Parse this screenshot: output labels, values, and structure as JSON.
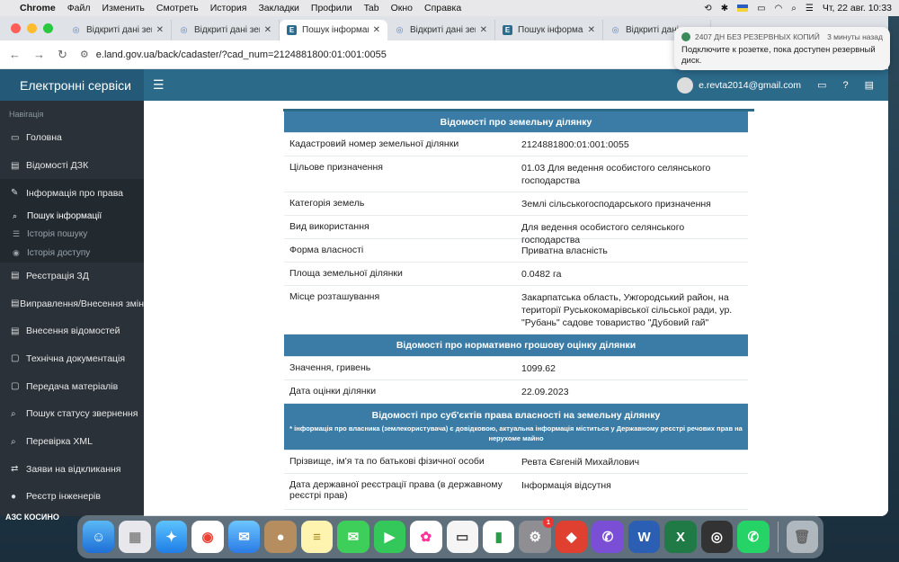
{
  "menubar": {
    "app": "Chrome",
    "items": [
      "Файл",
      "Изменить",
      "Смотреть",
      "История",
      "Закладки",
      "Профили",
      "Tab",
      "Окно",
      "Справка"
    ],
    "clock": "Чт, 22 авг.  10:33"
  },
  "tabs": [
    {
      "title": "Відкриті дані зем",
      "icon": "globe-icon"
    },
    {
      "title": "Відкриті дані зем",
      "icon": "globe-icon"
    },
    {
      "title": "Пошук інформац",
      "icon": "e-icon",
      "active": true
    },
    {
      "title": "Відкриті дані зем",
      "icon": "globe-icon"
    },
    {
      "title": "Пошук інформац",
      "icon": "e-icon"
    },
    {
      "title": "Відкриті дані зе",
      "icon": "globe-icon"
    }
  ],
  "address": {
    "url": "e.land.gov.ua/back/cadaster/?cad_num=2124881800:01:001:0055"
  },
  "header": {
    "brand": "Електронні сервіси",
    "user": "e.revta2014@gmail.com"
  },
  "sidebar": {
    "nav_label": "Навігація",
    "items": [
      {
        "label": "Головна",
        "icon": "monitor-icon"
      },
      {
        "label": "Відомості ДЗК",
        "icon": "book-icon"
      },
      {
        "label": "Інформація про права",
        "icon": "edit-icon",
        "active": true
      }
    ],
    "subitems": [
      {
        "label": "Пошук інформації",
        "icon": "search-icon",
        "current": true
      },
      {
        "label": "Історія пошуку",
        "icon": "list-icon"
      },
      {
        "label": "Історія доступу",
        "icon": "eye-icon"
      }
    ],
    "items2": [
      {
        "label": "Реєстрація ЗД",
        "icon": "book-icon"
      },
      {
        "label": "Виправлення/Внесення змін",
        "icon": "book-icon"
      },
      {
        "label": "Внесення відомостей",
        "icon": "book-icon"
      },
      {
        "label": "Технічна документація",
        "icon": "doc-icon"
      },
      {
        "label": "Передача матеріалів",
        "icon": "doc-icon"
      },
      {
        "label": "Пошук статусу звернення",
        "icon": "search-icon"
      },
      {
        "label": "Перевірка XML",
        "icon": "search-icon"
      },
      {
        "label": "Заяви на відкликання",
        "icon": "exchange-icon"
      },
      {
        "label": "Реєстр інженерів",
        "icon": "user-icon"
      }
    ]
  },
  "parcel": {
    "h1": "Відомості про земельну ділянку",
    "rows": [
      {
        "k": "Кадастровий номер земельної ділянки",
        "v": "2124881800:01:001:0055"
      },
      {
        "k": "Цільове призначення",
        "v": "01.03 Для ведення особистого селянського господарства"
      },
      {
        "k": "Категорія земель",
        "v": "Землі сільськогосподарського призначення"
      },
      {
        "k": "Вид використання",
        "v": "Для ведення особистого селянського господарства"
      },
      {
        "k": "Форма власності",
        "v": "Приватна власність"
      },
      {
        "k": "Площа земельної ділянки",
        "v": "0.0482 га"
      },
      {
        "k": "Місце розташування",
        "v": "Закарпатська область, Ужгородський район, на території Руськокомарівської сільської ради, ур. \"Рубань\" садове товариство \"Дубовий гай\""
      }
    ],
    "h2": "Відомості про нормативно грошову оцінку ділянки",
    "rows2": [
      {
        "k": "Значення, гривень",
        "v": "1099.62"
      },
      {
        "k": "Дата оцінки ділянки",
        "v": "22.09.2023"
      }
    ],
    "h3": "Відомості про суб'єктів права власності на земельну ділянку",
    "h3_note": "* інформація про власника (землекористувача) є довідковою, актуальна інформація міститься у Державному реєстрі речових прав на нерухоме майно",
    "rows3": [
      {
        "k": "Прізвище, ім'я та по батькові фізичної особи",
        "v": "Ревта Євгеній Михайлович"
      },
      {
        "k": "Дата державної реєстрації права (в державному реєстрі прав)",
        "v": "Інформація відсутня"
      }
    ]
  },
  "notification": {
    "title": "2407 ДН БЕЗ РЕЗЕРВНЫХ КОПИЙ",
    "time": "3 минуты назад",
    "body": "Подключите к розетке, пока доступен резервный диск."
  },
  "desktop": {
    "label": "АЗС КОСИНО"
  },
  "dock": {
    "badge": "1"
  }
}
